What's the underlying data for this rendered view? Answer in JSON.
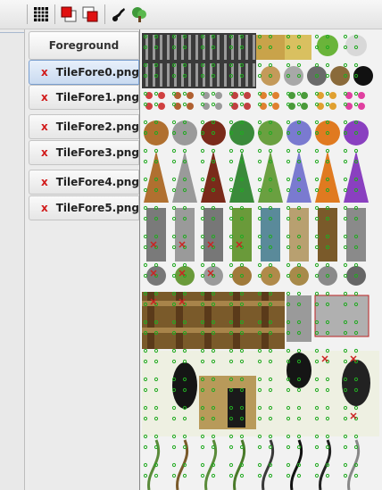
{
  "toolbar": {
    "icons": [
      "grid-icon",
      "layer-foreground-icon",
      "layer-background-icon",
      "paint-brush-icon",
      "tree-icon"
    ]
  },
  "tabs": {
    "header": "Foreground",
    "items": [
      {
        "close": "x",
        "label": "TileFore0.png",
        "selected": true
      },
      {
        "close": "x",
        "label": "TileFore1.png",
        "selected": false
      },
      {
        "close": "x",
        "label": "TileFore2.png",
        "selected": false
      },
      {
        "close": "x",
        "label": "TileFore3.png",
        "selected": false
      },
      {
        "close": "x",
        "label": "TileFore4.png",
        "selected": false
      },
      {
        "close": "x",
        "label": "TileFore5.png",
        "selected": false
      }
    ]
  },
  "colors": {
    "selected_tab": "#c9daf0",
    "close_x": "#d11a1a",
    "grid_dot": "#22aa22",
    "blocked_mark": "#cc2222"
  }
}
